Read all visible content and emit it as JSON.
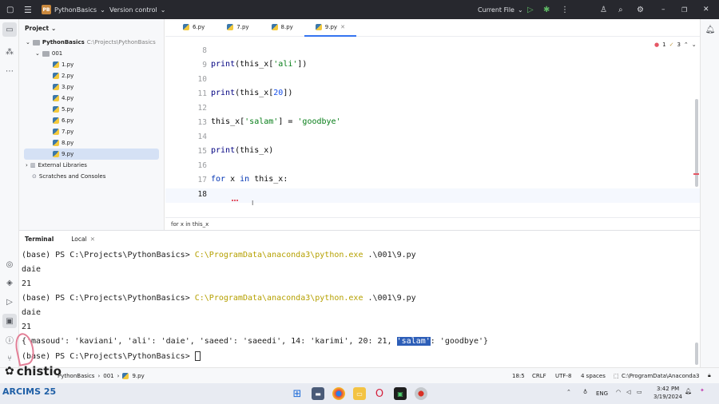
{
  "titlebar": {
    "project_badge": "PB",
    "project_name": "PythonBasics",
    "vcs": "Version control",
    "run_config": "Current File"
  },
  "project_panel": {
    "title": "Project",
    "root_name": "PythonBasics",
    "root_path": "C:\\Projects\\PythonBasics",
    "folder": "001",
    "files": [
      "1.py",
      "2.py",
      "3.py",
      "4.py",
      "5.py",
      "6.py",
      "7.py",
      "8.py",
      "9.py"
    ],
    "external_libraries": "External Libraries",
    "scratches": "Scratches and Consoles"
  },
  "editor": {
    "tabs": [
      "6.py",
      "7.py",
      "8.py",
      "9.py"
    ],
    "active_tab": "9.py",
    "inspections": {
      "errors": "1",
      "warnings": "3"
    },
    "line_numbers": [
      "8",
      "9",
      "10",
      "11",
      "12",
      "13",
      "14",
      "15",
      "16",
      "17",
      "18"
    ],
    "breadcrumb": "for x in this_x"
  },
  "terminal": {
    "tab_terminal": "Terminal",
    "tab_local": "Local",
    "prompt1": "(base) PS C:\\Projects\\PythonBasics> ",
    "cmd": "C:\\ProgramData\\anaconda3\\python.exe",
    "arg": " .\\001\\9.py",
    "out1": "daie",
    "out2": "21",
    "prompt2": "(base) PS C:\\Projects\\PythonBasics> ",
    "out3": "daie",
    "out4": "21",
    "dict_before": "{'masoud': 'kaviani', 'ali': 'daie', 'saeed': 'saeedi', 14: 'karimi', 20: 21, ",
    "dict_highlight": "'salam'",
    "dict_after": ": 'goodbye'}",
    "prompt3": "(base) PS C:\\Projects\\PythonBasics> "
  },
  "statusbar": {
    "crumb_root": "PythonBasics",
    "crumb_folder": "001",
    "crumb_file": "9.py",
    "position": "18:5",
    "line_sep": "CRLF",
    "encoding": "UTF-8",
    "indent": "4 spaces",
    "interpreter": "C:\\ProgramData\\Anaconda3"
  },
  "watermarks": {
    "brand": "chistio",
    "event": "ARCIMS 25"
  },
  "taskbar": {
    "lang": "ENG",
    "time": "3:42 PM",
    "date": "3/19/2024"
  },
  "colors": {
    "keyword": "#0033b3",
    "string": "#067d17",
    "number": "#1750eb",
    "accent": "#3574f0",
    "terminal_cmd": "#b5a000"
  }
}
